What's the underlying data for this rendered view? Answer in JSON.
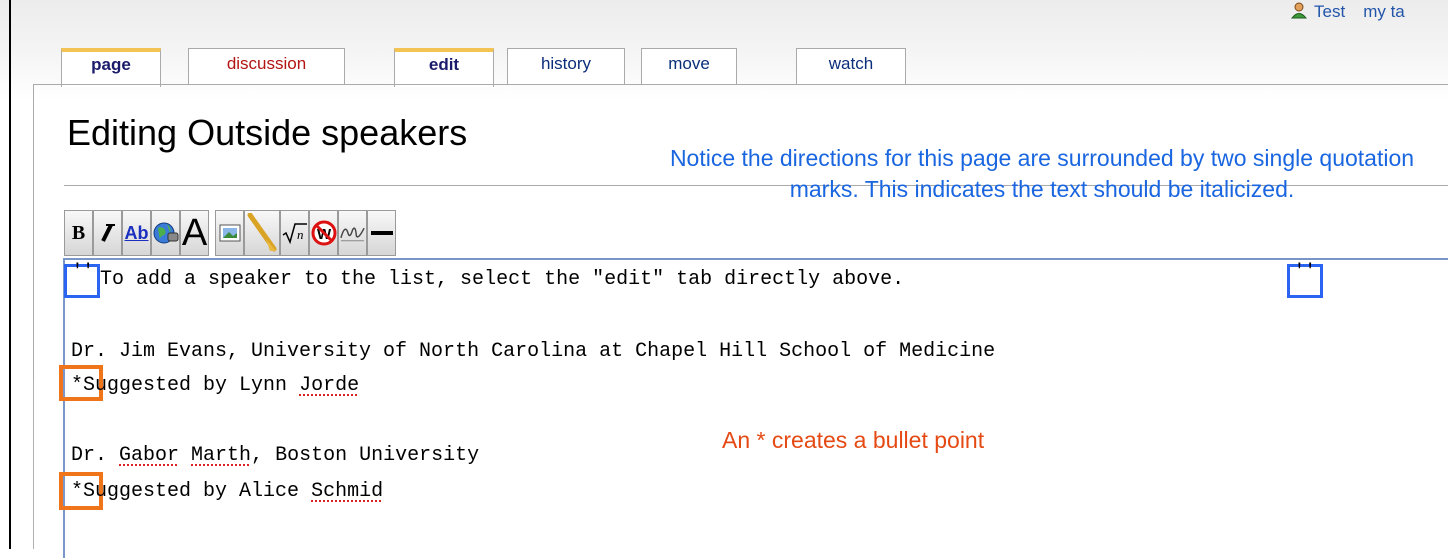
{
  "user_bar": {
    "username": "Test",
    "my_talk": "my ta"
  },
  "tabs": {
    "page": "page",
    "discussion": "discussion",
    "edit": "edit",
    "history": "history",
    "move": "move",
    "watch": "watch"
  },
  "page_title": "Editing Outside speakers",
  "annotations": {
    "quotes_note": "Notice the directions for this page are surrounded by two single quotation marks. This indicates the text should be italicized.",
    "bullet_note": "An * creates a bullet point"
  },
  "toolbar": {
    "icons": [
      "bold-icon",
      "italic-icon",
      "internal-link-icon",
      "external-link-icon",
      "headline-icon",
      "embedded-image-icon",
      "media-file-icon",
      "math-formula-icon",
      "nowiki-icon",
      "signature-icon",
      "horizontal-line-icon"
    ],
    "bold_glyph": "B",
    "link_glyph": "Ab",
    "headline_glyph": "A"
  },
  "editor": {
    "quote_mark": "''",
    "line1": "To add a speaker to the list, select the \"edit\" tab directly above.",
    "line2": "Dr. Jim Evans, University of North Carolina at Chapel Hill School of Medicine",
    "line3_bullet": "*S",
    "line3_rest": "uggested by Lynn ",
    "line3_name": "Jorde",
    "line4_pre": "Dr. ",
    "line4_name1": "Gabor",
    "line4_space": " ",
    "line4_name2": "Marth",
    "line4_rest": ", Boston University",
    "line5_bullet": "*S",
    "line5_rest": "uggested by Alice ",
    "line5_name": "Schmid"
  },
  "colors": {
    "annotation_blue": "#1a66e0",
    "annotation_orange": "#e54a14",
    "highlight_box_blue": "#2a64f0",
    "highlight_box_orange": "#f07419",
    "selected_tab_accent": "#f3c353",
    "link_blue": "#0b2e7a",
    "red_link": "#b31414"
  }
}
